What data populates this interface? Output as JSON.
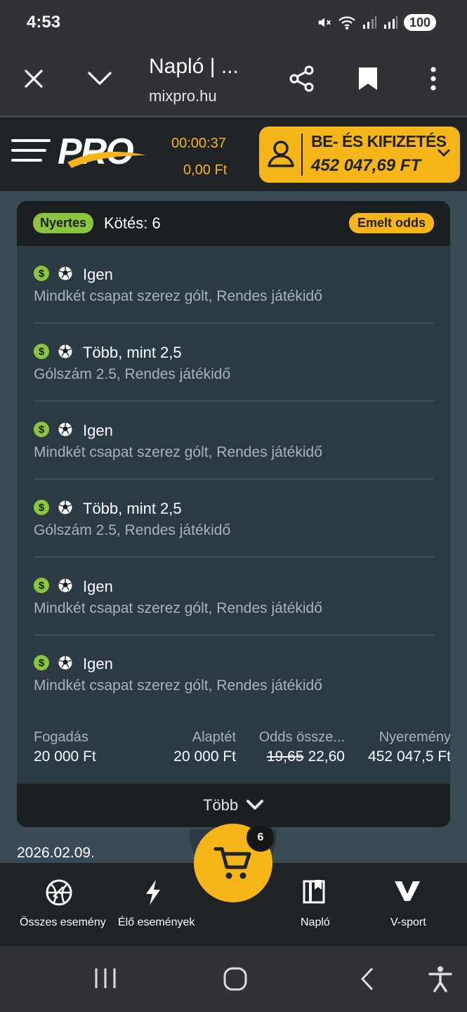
{
  "status_bar": {
    "time": "4:53",
    "battery": "100"
  },
  "browser": {
    "title": "Napló | ...",
    "url": "mixpro.hu"
  },
  "header": {
    "logo_text": "PRO",
    "timer": "00:00:37",
    "balance": "0,00 Ft",
    "pay_label": "BE- ÉS KIFIZETÉS",
    "pay_amount": "452 047,69 FT"
  },
  "bet": {
    "status_badge": "Nyertes",
    "bet_count": "Kötés: 6",
    "odds_badge": "Emelt odds",
    "selections": [
      {
        "name": "Igen",
        "market": "Mindkét csapat szerez gólt, Rendes játékidő"
      },
      {
        "name": "Több, mint 2,5",
        "market": "Gólszám 2.5, Rendes játékidő"
      },
      {
        "name": "Igen",
        "market": "Mindkét csapat szerez gólt, Rendes játékidő"
      },
      {
        "name": "Több, mint 2,5",
        "market": "Gólszám 2.5, Rendes játékidő"
      },
      {
        "name": "Igen",
        "market": "Mindkét csapat szerez gólt, Rendes játékidő"
      },
      {
        "name": "Igen",
        "market": "Mindkét csapat szerez gólt, Rendes játékidő"
      }
    ],
    "summary": {
      "stake_label": "Fogadás",
      "stake_value": "20 000 Ft",
      "base_label": "Alaptét",
      "base_value": "20 000 Ft",
      "odds_label": "Odds össze...",
      "odds_old": "19,65",
      "odds_new": "22,60",
      "win_label": "Nyeremény",
      "win_value": "452 047,5 Ft"
    },
    "more_label": "Több"
  },
  "date": "2026.02.09.",
  "cart": {
    "count": "6"
  },
  "bottom_nav": {
    "all_events": "Összes esemény",
    "live_events": "Élő események",
    "journal": "Napló",
    "vsport": "V-sport"
  },
  "colors": {
    "accent": "#f6b519",
    "win_green": "#8bc43f",
    "dark": "#1f2326"
  }
}
